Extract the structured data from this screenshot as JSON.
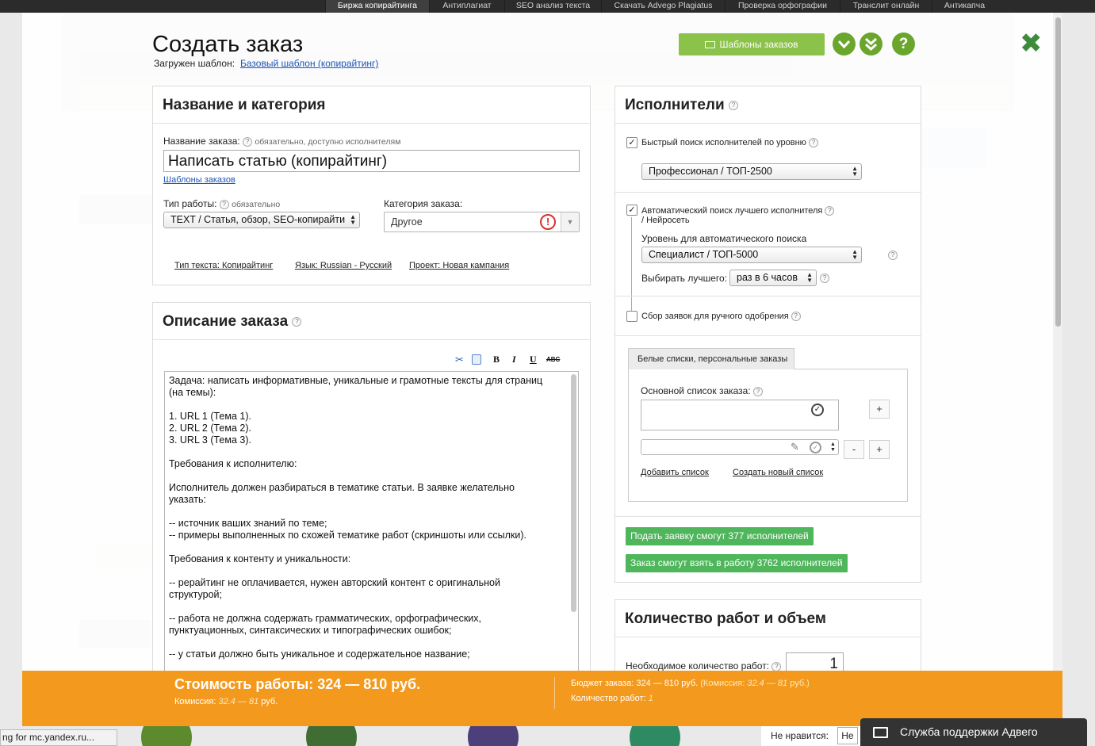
{
  "topnav": [
    "Биржа копирайтинга",
    "Антиплагиат",
    "SEO анализ текста",
    "Скачать Advego Plagiatus",
    "Проверка орфографии",
    "Транслит онлайн",
    "Антикапча"
  ],
  "modal": {
    "title": "Создать заказ",
    "template_label": "Загружен шаблон:",
    "template_link": "Базовый шаблон (копирайтинг)",
    "templates_button": "Шаблоны заказов",
    "close": "✖"
  },
  "name_panel": {
    "header": "Название и категория",
    "order_name_label": "Название заказа:",
    "order_name_hint": "обязательно, доступно исполнителям",
    "order_name_value": "Написать статью (копирайтинг)",
    "templates_link": "Шаблоны заказов",
    "work_type_label": "Тип работы:",
    "work_type_hint": "обязательно",
    "work_type_value": "TEXT / Статья, обзор, SEO-копирайти",
    "category_label": "Категория заказа:",
    "category_value": "Другое",
    "text_type": "Тип текста: Копирайтинг",
    "language": "Язык: Russian - Русский",
    "project": "Проект: Новая кампания"
  },
  "desc_panel": {
    "header": "Описание заказа",
    "toolbar": [
      "B",
      "I",
      "U",
      "ABC"
    ],
    "lines": [
      "Задача: написать информативные, уникальные и грамотные тексты для страниц",
      "(на темы):",
      "",
      "1. URL 1 (Тема 1).",
      "2. URL 2 (Тема 2).",
      "3. URL 3 (Тема 3).",
      "",
      "Требования к исполнителю:",
      "",
      "Исполнитель должен разбираться в тематике статьи. В заявке желательно",
      "указать:",
      "",
      "-- источник ваших знаний по теме;",
      "-- примеры выполненных по схожей тематике работ (скриншоты или ссылки).",
      "",
      "Требования к контенту и уникальности:",
      "",
      "-- рерайтинг не оплачивается, нужен авторский контент с оригинальной",
      "структурой;",
      "",
      "-- работа не должна содержать грамматических, орфографических,",
      "пунктуационных, синтаксических и типографических ошибок;",
      "",
      "-- у статьи должно быть уникальное и содержательное название;"
    ]
  },
  "performers_panel": {
    "header": "Исполнители",
    "quick_search_label": "Быстрый поиск исполнителей по уровню",
    "quick_search_level": "Профессионал / ТОП-2500",
    "auto_search_label_1": "Автоматический поиск лучшего исполнителя",
    "auto_search_label_2": "/ Нейросеть",
    "auto_level_label": "Уровень для автоматического поиска",
    "auto_level_value": "Специалист / ТОП-5000",
    "choose_best_label": "Выбирать лучшего:",
    "choose_best_value": "раз в 6 часов",
    "manual_collect_label": "Сбор заявок для ручного одобрения",
    "whitelist_tab": "Белые списки, персональные заказы",
    "main_list_label": "Основной список заказа:",
    "add_list": "Добавить список",
    "create_list": "Создать новый список",
    "apply_button": "Подать заявку смогут 377 исполнителей",
    "take_button": "Заказ смогут взять в работу 3762 исполнителей",
    "plus": "+",
    "minus": "-"
  },
  "quantity_panel": {
    "header": "Количество работ и объем",
    "count_label": "Необходимое количество работ:",
    "count_value": "1"
  },
  "bottom": {
    "cost": "Стоимость работы: 324 — 810 руб.",
    "commission_label": "Комиссия:",
    "commission_value": "32.4 — 81",
    "rub": "руб.",
    "budget": "Бюджет заказа: 324 — 810 руб.",
    "budget_commission": "(Комиссия:",
    "budget_commission_value": "32.4 — 81",
    "budget_commission_end": "руб.)",
    "count_label": "Количество работ:",
    "count_value": "1"
  },
  "status_url": "ng for mc.yandex.ru...",
  "dislike_label": "Не нравится:",
  "dislike_value": "Не",
  "support": "Служба поддержки Адвего",
  "colors": {
    "green": "#8ac24a",
    "green_dark": "#6aa62c",
    "orange": "#f39a1e",
    "apply_green": "#4fb65c",
    "alert_red": "#d9302c"
  }
}
